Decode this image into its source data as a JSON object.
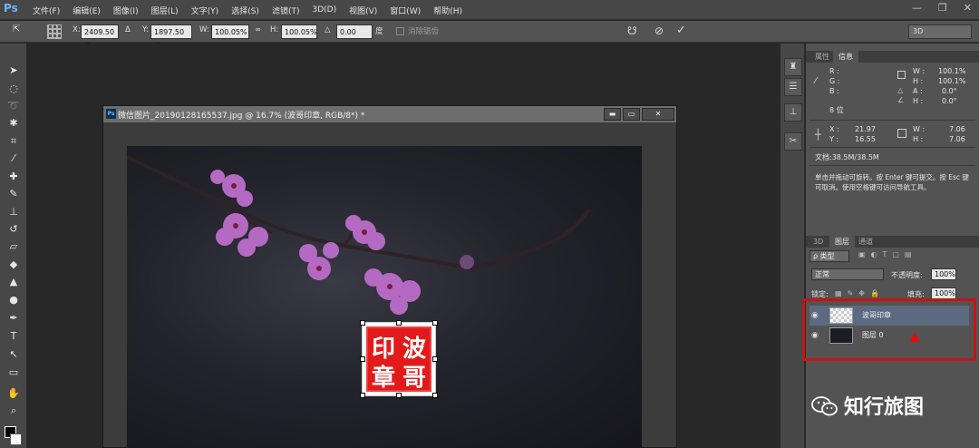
{
  "app": {
    "logo": "Ps"
  },
  "menu": [
    "文件(F)",
    "编辑(E)",
    "图像(I)",
    "图层(L)",
    "文字(Y)",
    "选择(S)",
    "滤镜(T)",
    "3D(D)",
    "视图(V)",
    "窗口(W)",
    "帮助(H)"
  ],
  "window_controls": {
    "minimize": "—",
    "restore": "❐",
    "close": "✕"
  },
  "options": {
    "x_label": "X:",
    "x_value": "2409.50 像",
    "delta_label": "Δ",
    "y_label": "Y:",
    "y_value": "1897.50 像",
    "w_label": "W:",
    "w_value": "100.05%",
    "link": "∞",
    "h_label": "H:",
    "h_value": "100.05%",
    "angle_label": "△",
    "angle_value": "0.00",
    "angle_unit": "度",
    "antialias": "消除锯齿",
    "workspace": "3D"
  },
  "document": {
    "ps_badge": "Ps",
    "title": "微信图片_20190128165537.jpg @ 16.7% (波哥印章, RGB/8*) *",
    "min": "▬",
    "max": "▭",
    "close": "✕"
  },
  "seal": {
    "chars": [
      "波",
      "哥",
      "印",
      "章"
    ],
    "color": "#e21a1a"
  },
  "info_panel": {
    "tab_properties": "属性",
    "tab_info": "信息",
    "r_label": "R :",
    "g_label": "G :",
    "b_label": "B :",
    "bit_depth": "8 位",
    "w_label": "W :",
    "w_value": "100.1%",
    "h_label": "H :",
    "h_value": "100.1%",
    "a_label": "A :",
    "a_value": "0.0°",
    "h2_label": "H :",
    "h2_value": "0.0°",
    "x_label": "X :",
    "x_value": "21.97",
    "y_label": "Y :",
    "y_value": "16.55",
    "w2_label": "W :",
    "w2_value": "7.06",
    "h3_label": "H :",
    "h3_value": "7.06",
    "doc_size": "文档:38.5M/38.5M",
    "hint": "单击并拖动可旋转。按 Enter 键可提交。按 Esc 键可取消。使用空格键可访问导航工具。"
  },
  "layers_panel": {
    "tab_3d": "3D",
    "tab_layers": "图层",
    "tab_channels": "通道",
    "filter": "ρ 类型",
    "blend_mode": "正常",
    "opacity_label": "不透明度:",
    "opacity_value": "100%",
    "lock_label": "锁定:",
    "fill_label": "填充:",
    "fill_value": "100%",
    "layers": [
      {
        "name": "波哥印章"
      },
      {
        "name": "图层 0"
      }
    ]
  },
  "watermark": {
    "text": "知行旅图"
  }
}
